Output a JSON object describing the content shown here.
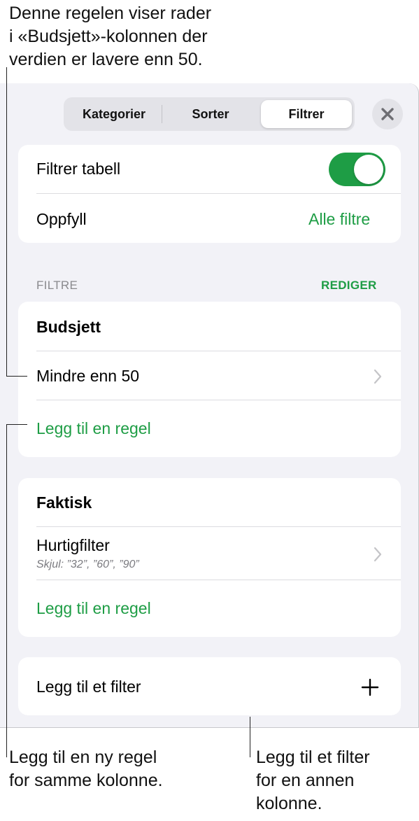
{
  "callouts": {
    "top": "Denne regelen viser rader\ni «Budsjett»-kolonnen der\nverdien er lavere enn 50.",
    "bottom_left": "Legg til en ny regel\nfor samme kolonne.",
    "bottom_right": "Legg til et filter\nfor en annen\nkolonne."
  },
  "tabs": [
    {
      "label": "Kategorier",
      "selected": false
    },
    {
      "label": "Sorter",
      "selected": false
    },
    {
      "label": "Filtrer",
      "selected": true
    }
  ],
  "close_icon": "xmark-icon",
  "settings": {
    "filter_table_label": "Filtrer tabell",
    "filter_table_on": true,
    "fill_label": "Oppfyll",
    "fill_value": "Alle filtre"
  },
  "filters_section": {
    "header": "FILTRE",
    "edit_label": "REDIGER"
  },
  "filters": [
    {
      "column": "Budsjett",
      "rule": "Mindre enn 50",
      "add_rule": "Legg til en regel"
    },
    {
      "column": "Faktisk",
      "rule": "Hurtigfilter",
      "rule_detail": "Skjul: ”32”, ”60”, ”90”",
      "add_rule": "Legg til en regel"
    }
  ],
  "add_filter": {
    "label": "Legg til et filter",
    "icon": "plus-icon"
  },
  "colors": {
    "accent": "#1e9d45",
    "panel_bg": "#f2f2f7"
  }
}
